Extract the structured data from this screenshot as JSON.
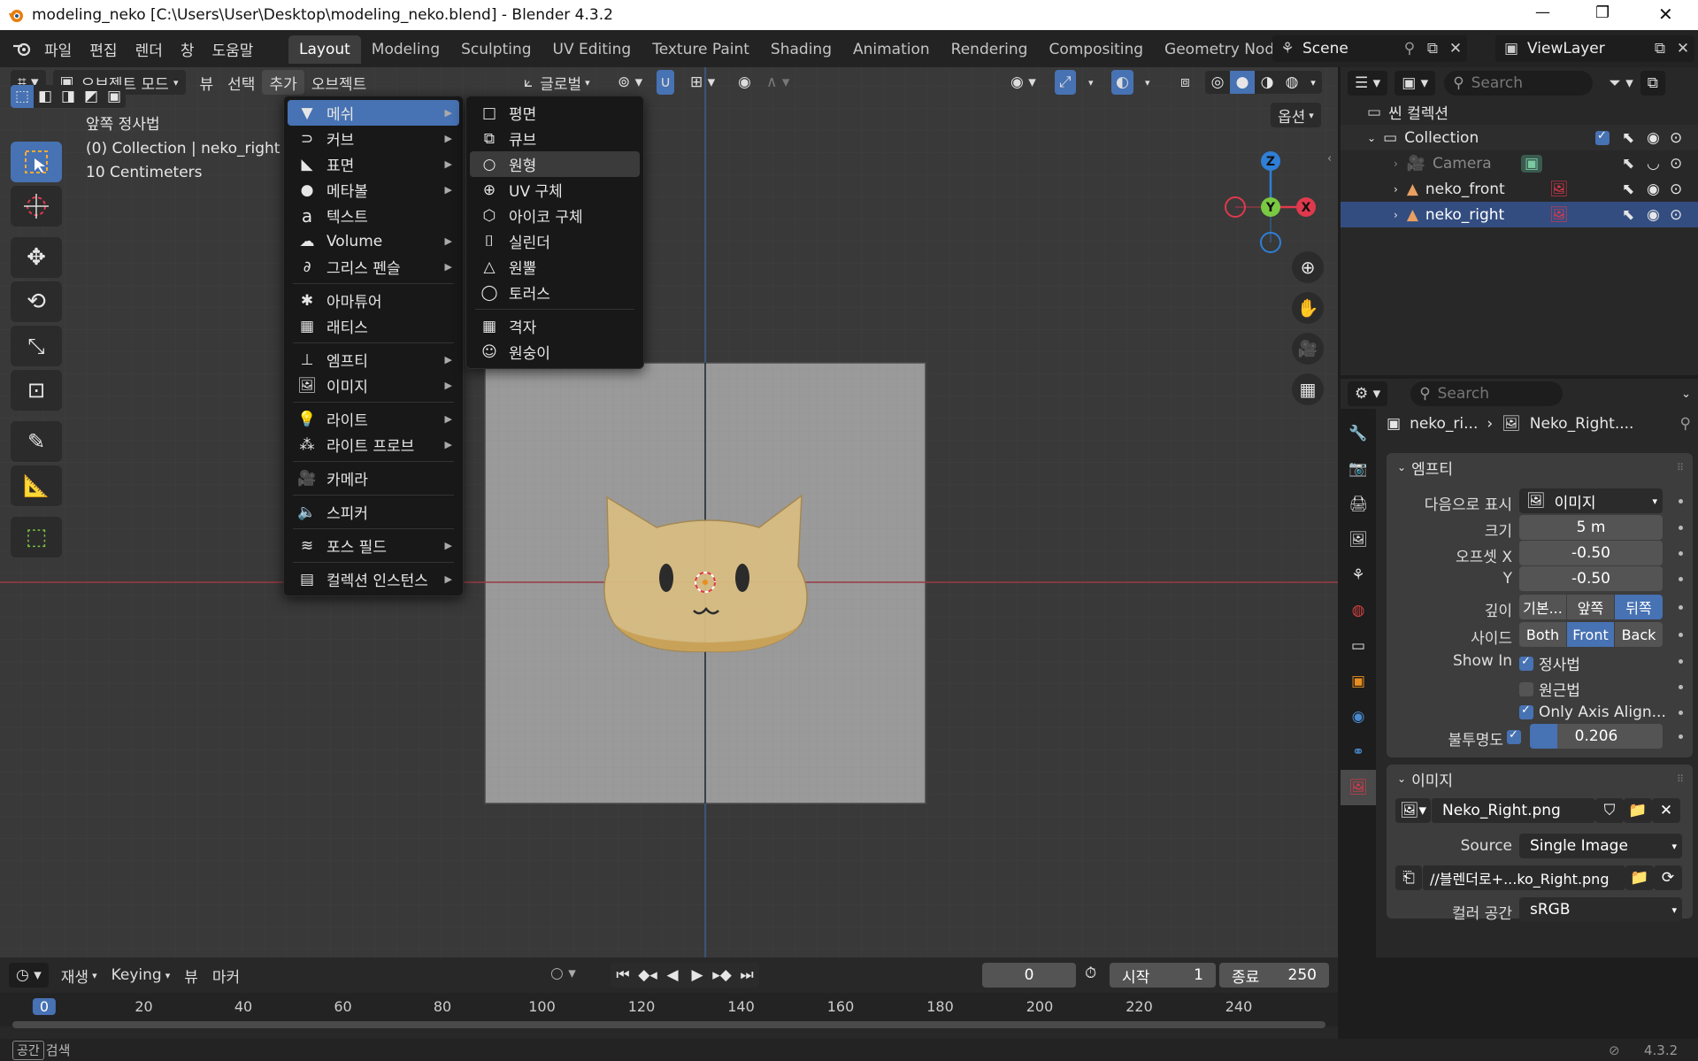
{
  "window": {
    "title": "modeling_neko [C:\\Users\\User\\Desktop\\modeling_neko.blend] - Blender 4.3.2",
    "minimize": "—",
    "maximize": "❐",
    "close": "✕"
  },
  "topbar": {
    "menus": [
      "파일",
      "편집",
      "렌더",
      "창",
      "도움말"
    ],
    "workspaces": [
      "Layout",
      "Modeling",
      "Sculpting",
      "UV Editing",
      "Texture Paint",
      "Shading",
      "Animation",
      "Rendering",
      "Compositing",
      "Geometry Node"
    ],
    "active_workspace": "Layout",
    "scene": "Scene",
    "view_layer": "ViewLayer"
  },
  "viewport_header": {
    "mode": "오브젝트 모드",
    "menus": [
      "뷰",
      "선택",
      "추가",
      "오브젝트"
    ],
    "transform_orientation": "글로벌",
    "options": "옵션"
  },
  "viewport_overlay": {
    "view_name": "앞쪽 정사법",
    "collection_info": "(0) Collection | neko_right",
    "scale": "10 Centimeters"
  },
  "gizmo": {
    "z": "Z",
    "y": "Y",
    "x": "X"
  },
  "add_menu": {
    "items": [
      {
        "label": "메쉬",
        "icon": "mesh-icon",
        "submenu": true
      },
      {
        "label": "커브",
        "icon": "curve-icon",
        "submenu": true
      },
      {
        "label": "표면",
        "icon": "surface-icon",
        "submenu": true
      },
      {
        "label": "메타볼",
        "icon": "metaball-icon",
        "submenu": true
      },
      {
        "label": "텍스트",
        "icon": "text-icon",
        "submenu": false
      },
      {
        "label": "Volume",
        "icon": "volume-icon",
        "submenu": true
      },
      {
        "label": "그리스 펜슬",
        "icon": "grease-pencil-icon",
        "submenu": true
      },
      {
        "label": "아마튜어",
        "icon": "armature-icon",
        "submenu": false
      },
      {
        "label": "래티스",
        "icon": "lattice-icon",
        "submenu": false
      },
      {
        "label": "엠프티",
        "icon": "empty-icon",
        "submenu": true
      },
      {
        "label": "이미지",
        "icon": "image-icon",
        "submenu": true
      },
      {
        "label": "라이트",
        "icon": "light-icon",
        "submenu": true
      },
      {
        "label": "라이트 프로브",
        "icon": "light-probe-icon",
        "submenu": true
      },
      {
        "label": "카메라",
        "icon": "camera-icon",
        "submenu": false
      },
      {
        "label": "스피커",
        "icon": "speaker-icon",
        "submenu": false
      },
      {
        "label": "포스 필드",
        "icon": "force-field-icon",
        "submenu": true
      },
      {
        "label": "컬렉션 인스턴스",
        "icon": "collection-instance-icon",
        "submenu": true
      }
    ]
  },
  "mesh_menu": {
    "items": [
      "평면",
      "큐브",
      "원형",
      "UV 구체",
      "아이코 구체",
      "실린더",
      "원뿔",
      "토러스",
      "격자",
      "원숭이"
    ],
    "highlighted": "원형"
  },
  "outliner": {
    "search_placeholder": "Search",
    "scene_collection": "씬 컬렉션",
    "collection": "Collection",
    "objects": [
      "Camera",
      "neko_front",
      "neko_right"
    ],
    "selected": "neko_right"
  },
  "properties": {
    "search_placeholder": "Search",
    "breadcrumb_object": "neko_ri...",
    "breadcrumb_data": "Neko_Right....",
    "empty_panel": {
      "title": "엠프티",
      "display_as_label": "다음으로 표시",
      "display_as_value": "이미지",
      "size_label": "크기",
      "size_value": "5 m",
      "offset_x_label": "오프셋 X",
      "offset_x_value": "-0.50",
      "offset_y_label": "Y",
      "offset_y_value": "-0.50",
      "depth_label": "깊이",
      "depth_options": [
        "기본...",
        "앞쪽",
        "뒤쪽"
      ],
      "depth_active": "뒤쪽",
      "side_label": "사이드",
      "side_options": [
        "Both",
        "Front",
        "Back"
      ],
      "side_active": "Front",
      "show_in_label": "Show In",
      "show_orthographic": "정사법",
      "show_perspective": "원근법",
      "only_axis_aligned": "Only Axis Align...",
      "opacity_label": "불투명도",
      "opacity_value": "0.206",
      "opacity_fraction": 0.206
    },
    "image_panel": {
      "title": "이미지",
      "image_name": "Neko_Right.png",
      "source_label": "Source",
      "source_value": "Single Image",
      "filepath": "//블렌더로+...ko_Right.png",
      "colorspace_label": "컬러 공간",
      "colorspace_value": "sRGB"
    }
  },
  "timeline": {
    "play_label": "재생",
    "keying_label": "Keying",
    "view_label": "뷰",
    "marker_label": "마커",
    "current_frame": "0",
    "start_label": "시작",
    "start_value": "1",
    "end_label": "종료",
    "end_value": "250",
    "ruler": [
      "0",
      "20",
      "40",
      "60",
      "80",
      "100",
      "120",
      "140",
      "160",
      "180",
      "200",
      "220",
      "240"
    ]
  },
  "statusbar": {
    "key": "공간",
    "action": "검색",
    "version": "4.3.2"
  },
  "colors": {
    "accent": "#4772b3",
    "x_axis": "#e0394d",
    "y_axis": "#7ac943",
    "z_axis": "#2f7fd6"
  }
}
